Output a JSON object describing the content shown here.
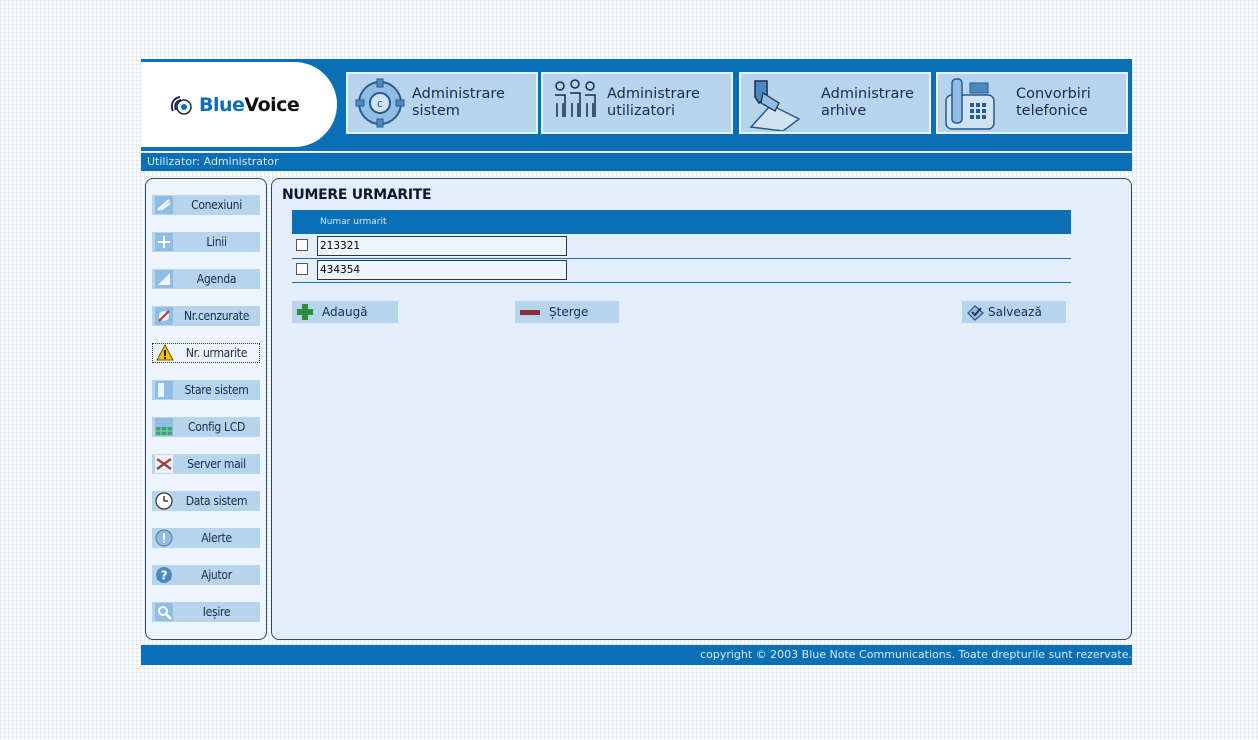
{
  "brand": {
    "name_part1": "Blue",
    "name_part2": "Voice"
  },
  "nav": [
    {
      "label": "Administrare\nsistem",
      "icon": "gear-icon"
    },
    {
      "label": "Administrare\nutilizatori",
      "icon": "users-icon"
    },
    {
      "label": "Administrare\narhive",
      "icon": "archive-icon"
    },
    {
      "label": "Convorbiri\ntelefonice",
      "icon": "phone-icon"
    }
  ],
  "userbar": {
    "text": "Utilizator: Administrator"
  },
  "sidebar": {
    "items": [
      {
        "label": "Conexiuni",
        "icon": "connection-icon"
      },
      {
        "label": "Linii",
        "icon": "lines-icon"
      },
      {
        "label": "Agenda",
        "icon": "agenda-icon"
      },
      {
        "label": "Nr.cenzurate",
        "icon": "censored-icon"
      },
      {
        "label": "Nr. urmarite",
        "icon": "warning-icon",
        "active": true
      },
      {
        "label": "Stare sistem",
        "icon": "status-icon"
      },
      {
        "label": "Config LCD",
        "icon": "lcd-icon"
      },
      {
        "label": "Server mail",
        "icon": "mail-icon"
      },
      {
        "label": "Data sistem",
        "icon": "clock-icon"
      },
      {
        "label": "Alerte",
        "icon": "alert-icon"
      },
      {
        "label": "Ajutor",
        "icon": "help-icon"
      },
      {
        "label": "Ieșire",
        "icon": "exit-icon"
      }
    ]
  },
  "main": {
    "title": "NUMERE URMARITE",
    "column_header": "Numar urmarit",
    "rows": [
      {
        "value": "213321",
        "checked": false
      },
      {
        "value": "434354",
        "checked": false
      }
    ],
    "buttons": {
      "add": "Adaugă",
      "delete": "Șterge",
      "save": "Salvează"
    }
  },
  "footer": {
    "text": "copyright © 2003 Blue Note Communications. Toate drepturile sunt rezervate."
  },
  "colors": {
    "header_blue": "#0a6fb5",
    "tile": "#b6d4ec",
    "panel": "#e3eef9"
  }
}
